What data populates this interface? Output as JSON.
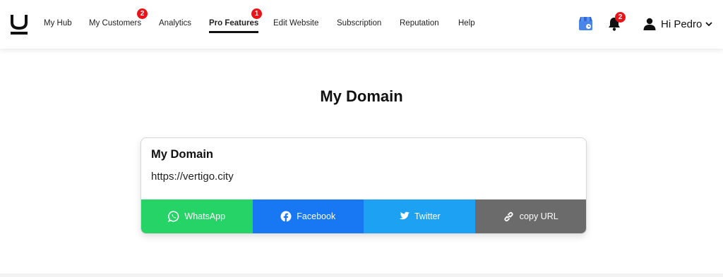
{
  "nav": {
    "items": [
      {
        "label": "My Hub"
      },
      {
        "label": "My Customers",
        "badge": "2"
      },
      {
        "label": "Analytics"
      },
      {
        "label": "Pro Features",
        "badge": "1",
        "active": true
      },
      {
        "label": "Edit Website"
      },
      {
        "label": "Subscription"
      },
      {
        "label": "Reputation"
      },
      {
        "label": "Help"
      }
    ],
    "notifications_badge": "2",
    "greeting": "Hi Pedro"
  },
  "page": {
    "title": "My Domain"
  },
  "card": {
    "title": "My Domain",
    "url": "https://vertigo.city",
    "share_buttons": [
      {
        "label": "WhatsApp",
        "icon": "whatsapp-icon",
        "color": "#25d366"
      },
      {
        "label": "Facebook",
        "icon": "facebook-icon",
        "color": "#1877f2"
      },
      {
        "label": "Twitter",
        "icon": "twitter-icon",
        "color": "#1da1f2"
      },
      {
        "label": "copy URL",
        "icon": "link-icon",
        "color": "#6b6b6b"
      }
    ]
  },
  "colors": {
    "badge": "#e8141a",
    "accent": "#111111"
  }
}
